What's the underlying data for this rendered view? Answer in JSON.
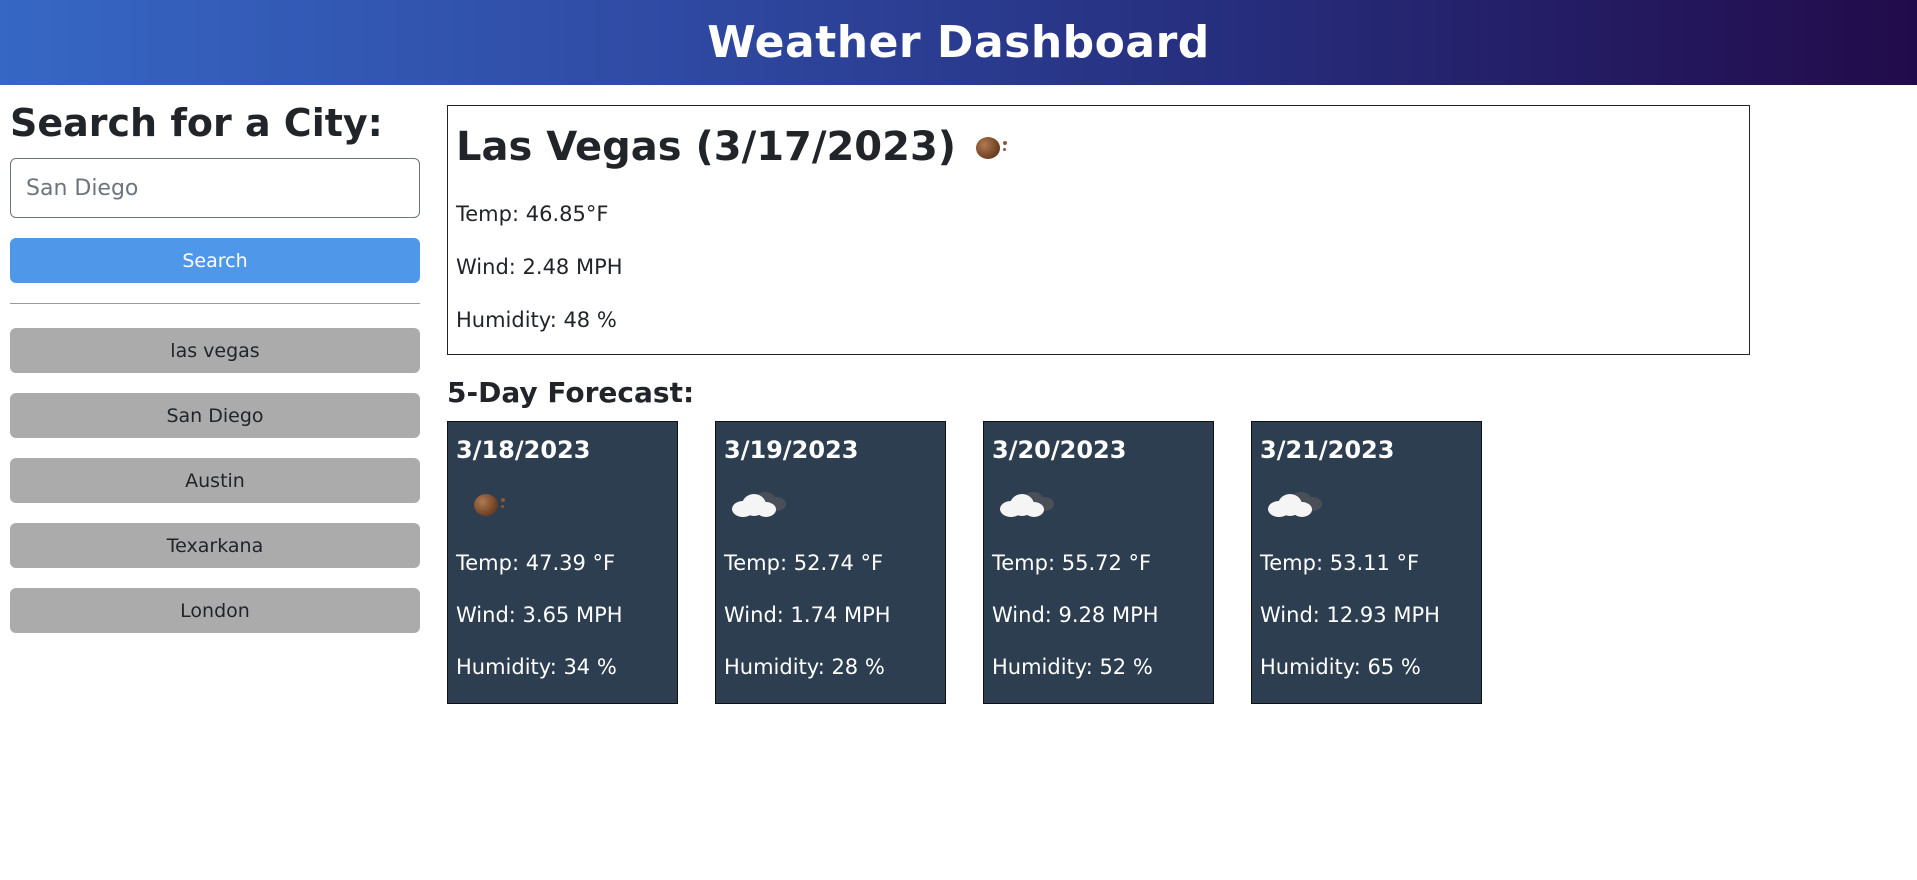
{
  "header": {
    "title": "Weather Dashboard"
  },
  "sidebar": {
    "heading": "Search for a City:",
    "search": {
      "value": "",
      "placeholder": "San Diego"
    },
    "search_label": "Search",
    "history": [
      "las vegas",
      "San Diego",
      "Austin",
      "Texarkana",
      "London"
    ]
  },
  "current": {
    "title": "Las Vegas (3/17/2023)",
    "icon": "haze-icon",
    "temp": "Temp: 46.85°F",
    "wind": "Wind: 2.48 MPH",
    "humidity": "Humidity: 48 %"
  },
  "forecast": {
    "title": "5-Day Forecast:",
    "days": [
      {
        "date": "3/18/2023",
        "icon": "haze-icon",
        "temp": "Temp: 47.39 °F",
        "wind": "Wind: 3.65 MPH",
        "humidity": "Humidity: 34 %"
      },
      {
        "date": "3/19/2023",
        "icon": "cloud-icon",
        "temp": "Temp: 52.74 °F",
        "wind": "Wind: 1.74 MPH",
        "humidity": "Humidity: 28 %"
      },
      {
        "date": "3/20/2023",
        "icon": "cloud-icon",
        "temp": "Temp: 55.72 °F",
        "wind": "Wind: 9.28 MPH",
        "humidity": "Humidity: 52 %"
      },
      {
        "date": "3/21/2023",
        "icon": "cloud-icon",
        "temp": "Temp: 53.11 °F",
        "wind": "Wind: 12.93 MPH",
        "humidity": "Humidity: 65 %"
      }
    ]
  },
  "colors": {
    "header_gradient_start": "#3667c4",
    "header_gradient_end": "#220b4a",
    "search_button": "#4f97e8",
    "history_button": "#ababab",
    "card_background": "#2c3e50"
  }
}
